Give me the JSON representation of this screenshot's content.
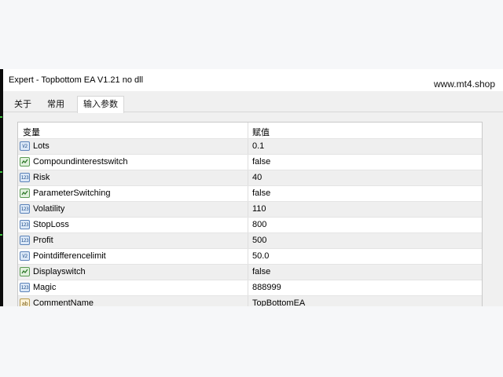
{
  "window": {
    "title": "Expert - Topbottom EA V1.21 no dll",
    "watermark": "www.mt4.shop"
  },
  "tabs": [
    {
      "label": "关于",
      "active": false
    },
    {
      "label": "常用",
      "active": false
    },
    {
      "label": "输入参数",
      "active": true
    }
  ],
  "table": {
    "headers": {
      "variable": "变量",
      "value": "赋值"
    },
    "rows": [
      {
        "icon": "double-icon",
        "icon_text": "V2",
        "name": "Lots",
        "value": "0.1"
      },
      {
        "icon": "bool-icon",
        "icon_text": "",
        "name": "Compoundinterestswitch",
        "value": "false"
      },
      {
        "icon": "int-icon",
        "icon_text": "123",
        "name": "Risk",
        "value": "40"
      },
      {
        "icon": "bool-icon",
        "icon_text": "",
        "name": "ParameterSwitching",
        "value": "false"
      },
      {
        "icon": "int-icon",
        "icon_text": "123",
        "name": "Volatility",
        "value": "110"
      },
      {
        "icon": "int-icon",
        "icon_text": "123",
        "name": "StopLoss",
        "value": "800"
      },
      {
        "icon": "int-icon",
        "icon_text": "123",
        "name": "Profit",
        "value": "500"
      },
      {
        "icon": "double-icon",
        "icon_text": "V2",
        "name": "Pointdifferencelimit",
        "value": "50.0"
      },
      {
        "icon": "bool-icon",
        "icon_text": "",
        "name": "Displayswitch",
        "value": "false"
      },
      {
        "icon": "int-icon",
        "icon_text": "123",
        "name": "Magic",
        "value": "888999"
      },
      {
        "icon": "string-icon",
        "icon_text": "ab",
        "name": "CommentName",
        "value": "TopBottomEA"
      }
    ]
  },
  "colors": {
    "row_alt": "#efefef",
    "panel_border": "#c9c9c9",
    "background": "#f6f7f9"
  }
}
